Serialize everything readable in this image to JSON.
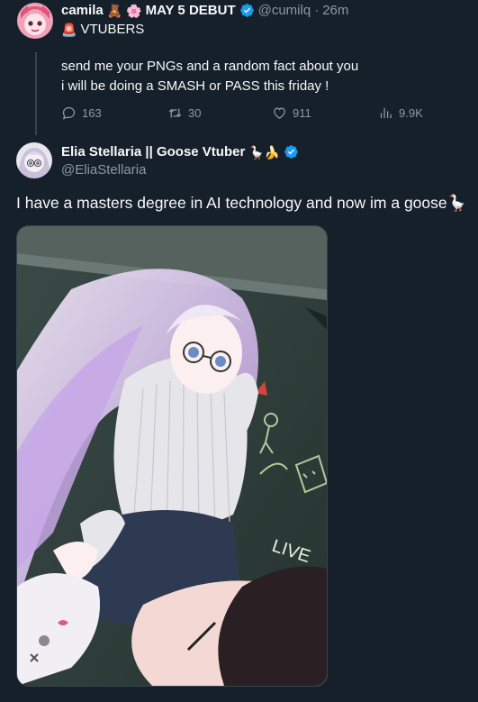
{
  "tweet1": {
    "display_name": "camila",
    "emoji1": "🧸",
    "emoji2": "🌸",
    "debut_text": "MAY 5 DEBUT",
    "handle": "@cumilq",
    "time": "26m",
    "subtitle_emoji": "🚨",
    "subtitle": "VTUBERS",
    "line1": "send me your PNGs and a random fact about you",
    "line2": "i will be doing a SMASH or PASS this friday !",
    "replies": "163",
    "retweets": "30",
    "likes": "911",
    "views": "9.9K"
  },
  "tweet2": {
    "display_name": "Elia Stellaria || Goose Vtuber",
    "name_emojis": "🪿🍌",
    "handle": "@EliaStellaria",
    "text": "I have a masters degree in AI technology and now im a goose🪿",
    "image_text": "LIVE"
  },
  "colors": {
    "background": "#15202b",
    "verified": "#1d9bf0",
    "muted": "#8b98a5",
    "divider": "#38444d"
  }
}
